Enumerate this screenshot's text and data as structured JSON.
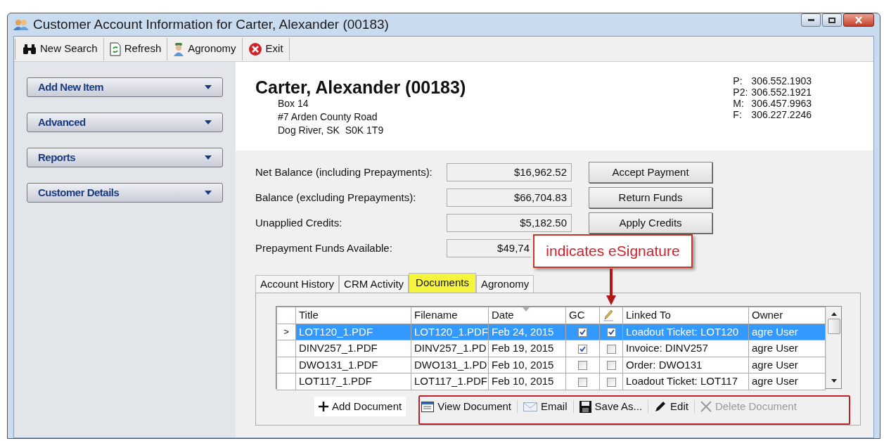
{
  "window": {
    "title": "Customer Account Information for Carter, Alexander (00183)"
  },
  "toolbar": [
    {
      "label": "New Search",
      "kind": "binoculars"
    },
    {
      "label": "Refresh",
      "kind": "refresh"
    },
    {
      "label": "Agronomy",
      "kind": "person"
    },
    {
      "label": "Exit",
      "kind": "exit"
    }
  ],
  "sidebar": {
    "items": [
      {
        "label": "Add New Item"
      },
      {
        "label": "Advanced"
      },
      {
        "label": "Reports"
      },
      {
        "label": "Customer Details"
      }
    ]
  },
  "customer": {
    "name": "Carter, Alexander (00183)",
    "address": [
      "Box 14",
      "#7 Arden County Road",
      "Dog River, SK  S0K 1T9"
    ],
    "phones": [
      {
        "label": "P:",
        "number": "306.552.1903"
      },
      {
        "label": "P2:",
        "number": "306.552.1921"
      },
      {
        "label": "M:",
        "number": "306.457.9963"
      },
      {
        "label": "F:",
        "number": "306.227.2246"
      }
    ]
  },
  "balances": [
    {
      "label": "Net Balance (including Prepayments):",
      "value": "$16,962.52",
      "action": "Accept Payment"
    },
    {
      "label": "Balance (excluding Prepayments):",
      "value": "$66,704.83",
      "action": "Return Funds"
    },
    {
      "label": "Unapplied Credits:",
      "value": "$5,182.50",
      "action": "Apply Credits"
    },
    {
      "label": "Prepayment Funds Available:",
      "value": "$49,74"
    }
  ],
  "callout": {
    "text": "indicates eSignature"
  },
  "tabs": [
    {
      "label": "Account History",
      "selected": false
    },
    {
      "label": "CRM Activity",
      "selected": false
    },
    {
      "label": "Documents",
      "selected": true
    },
    {
      "label": "Agronomy",
      "selected": false
    }
  ],
  "documents": {
    "columns": [
      "Title",
      "Filename",
      "Date",
      "GC",
      "Linked To",
      "Owner"
    ],
    "rows": [
      {
        "marker": ">",
        "title": "LOT120_1.PDF",
        "filename": "LOT120_1.PDF",
        "date": "Feb 24, 2015",
        "gc": true,
        "esignature": true,
        "linked_to": "Loadout Ticket: LOT120",
        "owner": "agre User",
        "selected": true
      },
      {
        "title": "DINV257_1.PDF",
        "filename": "DINV257_1.PD",
        "date": "Feb 19, 2015",
        "gc": true,
        "esignature": false,
        "linked_to": "Invoice: DINV257",
        "owner": "agre User",
        "selected": false
      },
      {
        "title": "DWO131_1.PDF",
        "filename": "DWO131_1.PD",
        "date": "Feb 10, 2015",
        "gc": false,
        "esignature": false,
        "linked_to": "Order: DWO131",
        "owner": "agre User",
        "selected": false
      },
      {
        "title": "LOT117_1.PDF",
        "filename": "LOT117_1.PDF",
        "date": "Feb 10, 2015",
        "gc": false,
        "esignature": false,
        "linked_to": "Loadout Ticket: LOT117",
        "owner": "agre User",
        "selected": false
      }
    ],
    "actions": [
      {
        "label": "Add Document",
        "kind": "add",
        "disabled": false
      },
      {
        "label": "View Document",
        "kind": "view",
        "disabled": false
      },
      {
        "label": "Email",
        "kind": "email",
        "disabled": false
      },
      {
        "label": "Save As...",
        "kind": "save",
        "disabled": false
      },
      {
        "label": "Edit",
        "kind": "edit",
        "disabled": false
      },
      {
        "label": "Delete Document",
        "kind": "delete",
        "disabled": true
      }
    ]
  }
}
